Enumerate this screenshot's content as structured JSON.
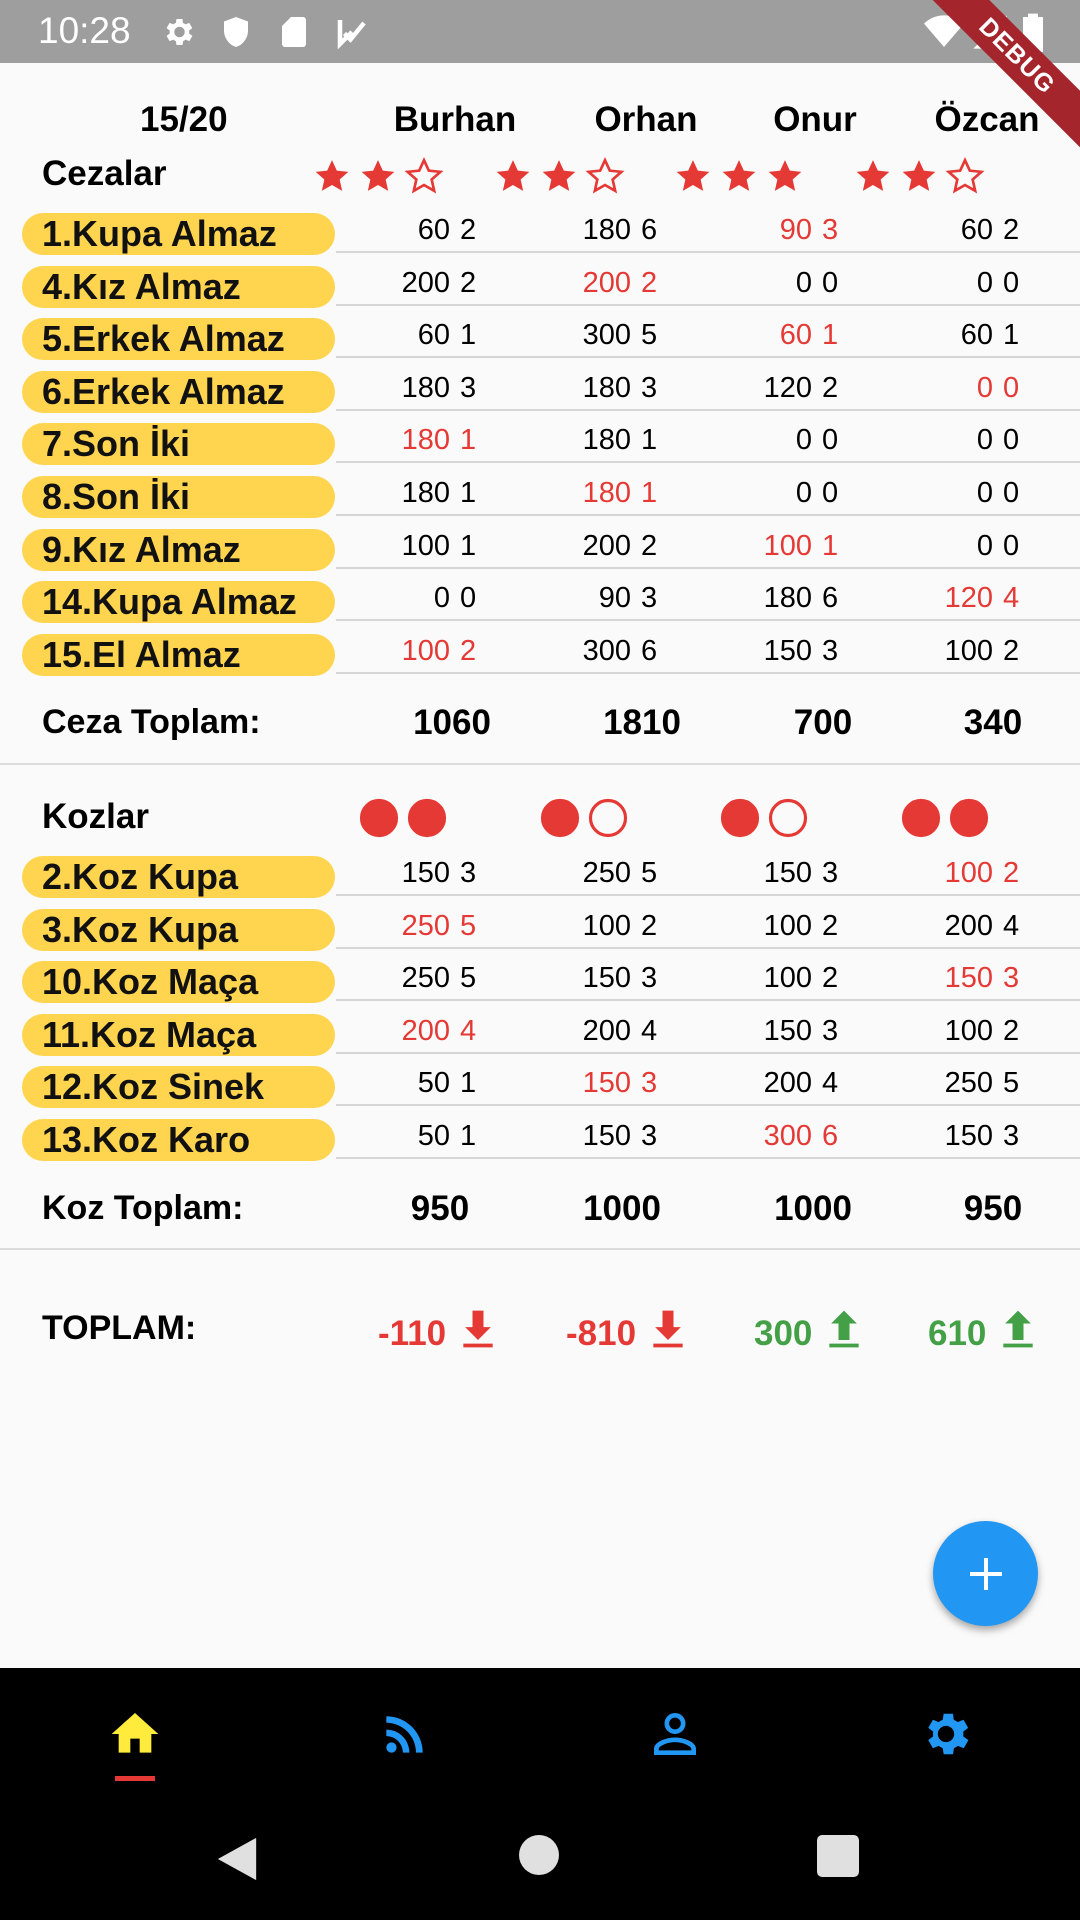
{
  "status_bar": {
    "time": "10:28",
    "debug_label": "DEBUG"
  },
  "header": {
    "round": "15/20",
    "players": [
      "Burhan",
      "Orhan",
      "Onur",
      "Özcan"
    ]
  },
  "cezalar": {
    "title": "Cezalar",
    "stars": [
      [
        1,
        1,
        0
      ],
      [
        1,
        1,
        0
      ],
      [
        1,
        1,
        1
      ],
      [
        1,
        1,
        0
      ]
    ],
    "rows": [
      {
        "label": "1.Kupa Almaz",
        "cells": [
          [
            "60",
            "2",
            false
          ],
          [
            "180",
            "6",
            false
          ],
          [
            "90",
            "3",
            true
          ],
          [
            "60",
            "2",
            false
          ]
        ]
      },
      {
        "label": "4.Kız Almaz",
        "cells": [
          [
            "200",
            "2",
            false
          ],
          [
            "200",
            "2",
            true
          ],
          [
            "0",
            "0",
            false
          ],
          [
            "0",
            "0",
            false
          ]
        ]
      },
      {
        "label": "5.Erkek Almaz",
        "cells": [
          [
            "60",
            "1",
            false
          ],
          [
            "300",
            "5",
            false
          ],
          [
            "60",
            "1",
            true
          ],
          [
            "60",
            "1",
            false
          ]
        ]
      },
      {
        "label": "6.Erkek Almaz",
        "cells": [
          [
            "180",
            "3",
            false
          ],
          [
            "180",
            "3",
            false
          ],
          [
            "120",
            "2",
            false
          ],
          [
            "0",
            "0",
            true
          ]
        ]
      },
      {
        "label": "7.Son İki",
        "cells": [
          [
            "180",
            "1",
            true
          ],
          [
            "180",
            "1",
            false
          ],
          [
            "0",
            "0",
            false
          ],
          [
            "0",
            "0",
            false
          ]
        ]
      },
      {
        "label": "8.Son İki",
        "cells": [
          [
            "180",
            "1",
            false
          ],
          [
            "180",
            "1",
            true
          ],
          [
            "0",
            "0",
            false
          ],
          [
            "0",
            "0",
            false
          ]
        ]
      },
      {
        "label": "9.Kız Almaz",
        "cells": [
          [
            "100",
            "1",
            false
          ],
          [
            "200",
            "2",
            false
          ],
          [
            "100",
            "1",
            true
          ],
          [
            "0",
            "0",
            false
          ]
        ]
      },
      {
        "label": "14.Kupa Almaz",
        "cells": [
          [
            "0",
            "0",
            false
          ],
          [
            "90",
            "3",
            false
          ],
          [
            "180",
            "6",
            false
          ],
          [
            "120",
            "4",
            true
          ]
        ]
      },
      {
        "label": "15.El Almaz",
        "cells": [
          [
            "100",
            "2",
            true
          ],
          [
            "300",
            "6",
            false
          ],
          [
            "150",
            "3",
            false
          ],
          [
            "100",
            "2",
            false
          ]
        ]
      }
    ],
    "total_label": "Ceza Toplam:",
    "totals": [
      "1060",
      "1810",
      "700",
      "340"
    ]
  },
  "kozlar": {
    "title": "Kozlar",
    "circles": [
      [
        1,
        1
      ],
      [
        1,
        0
      ],
      [
        1,
        0
      ],
      [
        1,
        1
      ]
    ],
    "rows": [
      {
        "label": "2.Koz Kupa",
        "cells": [
          [
            "150",
            "3",
            false
          ],
          [
            "250",
            "5",
            false
          ],
          [
            "150",
            "3",
            false
          ],
          [
            "100",
            "2",
            true
          ]
        ]
      },
      {
        "label": "3.Koz Kupa",
        "cells": [
          [
            "250",
            "5",
            true
          ],
          [
            "100",
            "2",
            false
          ],
          [
            "100",
            "2",
            false
          ],
          [
            "200",
            "4",
            false
          ]
        ]
      },
      {
        "label": "10.Koz Maça",
        "cells": [
          [
            "250",
            "5",
            false
          ],
          [
            "150",
            "3",
            false
          ],
          [
            "100",
            "2",
            false
          ],
          [
            "150",
            "3",
            true
          ]
        ]
      },
      {
        "label": "11.Koz Maça",
        "cells": [
          [
            "200",
            "4",
            true
          ],
          [
            "200",
            "4",
            false
          ],
          [
            "150",
            "3",
            false
          ],
          [
            "100",
            "2",
            false
          ]
        ]
      },
      {
        "label": "12.Koz Sinek",
        "cells": [
          [
            "50",
            "1",
            false
          ],
          [
            "150",
            "3",
            true
          ],
          [
            "200",
            "4",
            false
          ],
          [
            "250",
            "5",
            false
          ]
        ]
      },
      {
        "label": "13.Koz Karo",
        "cells": [
          [
            "50",
            "1",
            false
          ],
          [
            "150",
            "3",
            false
          ],
          [
            "300",
            "6",
            true
          ],
          [
            "150",
            "3",
            false
          ]
        ]
      }
    ],
    "total_label": "Koz Toplam:",
    "totals": [
      "950",
      "1000",
      "1000",
      "950"
    ]
  },
  "grand_total": {
    "label": "TOPLAM:",
    "values": [
      {
        "value": "-110",
        "direction": "down"
      },
      {
        "value": "-810",
        "direction": "down"
      },
      {
        "value": "300",
        "direction": "up"
      },
      {
        "value": "610",
        "direction": "up"
      }
    ]
  },
  "colors": {
    "red": "#e53935",
    "green": "#43a047",
    "accent": "#2196f3",
    "pill": "#ffd54f",
    "home_active": "#ffeb3b"
  },
  "nav": [
    "home-icon",
    "rss-feed-icon",
    "person-icon",
    "settings-icon"
  ],
  "fab_icon": "plus-icon"
}
